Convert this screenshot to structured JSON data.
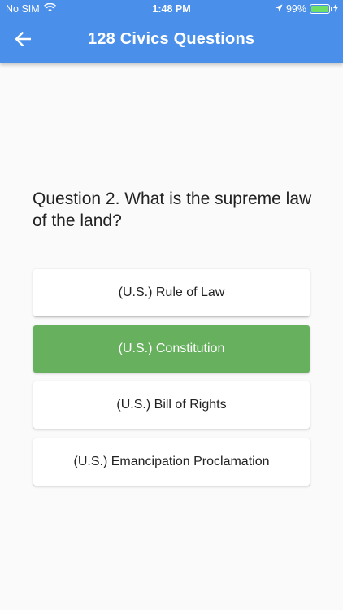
{
  "status_bar": {
    "carrier": "No SIM",
    "time": "1:48 PM",
    "battery_percent": "99%",
    "battery_level": 0.99,
    "battery_color": "#6ee06a"
  },
  "app_bar": {
    "title": "128 Civics Questions",
    "back_icon": "arrow-back-icon",
    "color": "#4a8fea"
  },
  "question": {
    "text": "Question 2. What is the supreme law of the land?"
  },
  "answers": [
    {
      "label": "(U.S.) Rule of Law",
      "selected_correct": false
    },
    {
      "label": "(U.S.) Constitution",
      "selected_correct": true
    },
    {
      "label": "(U.S.) Bill of Rights",
      "selected_correct": false
    },
    {
      "label": "(U.S.) Emancipation Proclamation",
      "selected_correct": false
    }
  ],
  "colors": {
    "correct_answer": "#66b05e",
    "background": "#fafafa"
  }
}
